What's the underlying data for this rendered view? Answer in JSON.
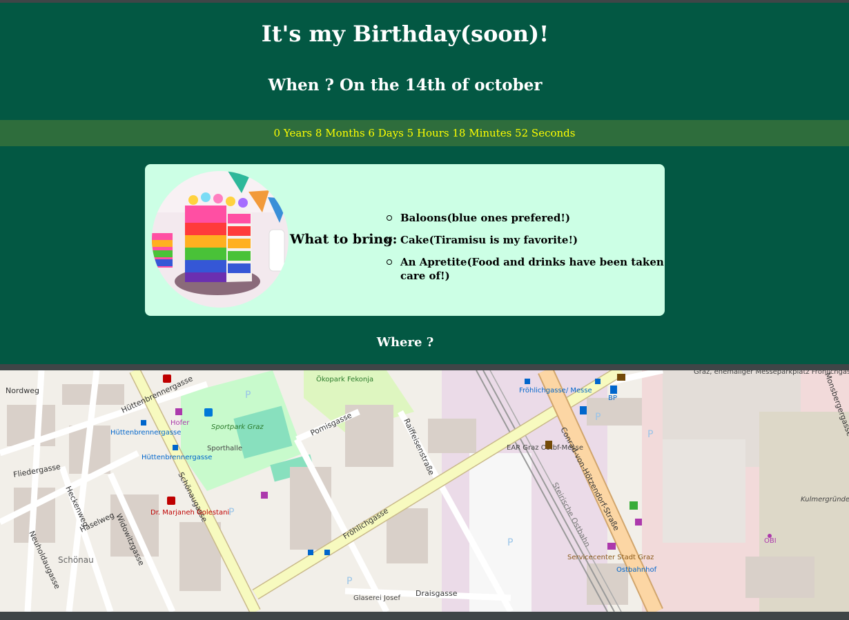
{
  "header": {
    "title": "It's my Birthday(soon)!",
    "subtitle": "When ? On the 14th of october"
  },
  "countdown": {
    "text": "0 Years 8 Months 6 Days 5 Hours 18 Minutes 52 Seconds"
  },
  "bring": {
    "label": "What to bring:",
    "items": [
      "Baloons(blue ones prefered!)",
      "Cake(Tiramisu is my favorite!)",
      "An Apretite(Food and drinks have been taken care of!)"
    ]
  },
  "where": {
    "label": "Where ?"
  },
  "map": {
    "streets": {
      "huettenbrennergasse": "Hüttenbrennergasse",
      "nordweg": "Nordweg",
      "fliedergasse": "Fliedergasse",
      "schoenaugasse": "Schönaugasse",
      "heckenweg": "Heckenweg",
      "haselweg": "Haselweg",
      "widowitzgasse": "Widowitzgasse",
      "neuholdaugasse": "Neuholdaugasse",
      "pomisgasse": "Pomisgasse",
      "raiffeisenstrasse": "Raiffeisenstraße",
      "froehlichgasse": "Fröhlichgasse",
      "draisgasse": "Draisgasse",
      "conrad": "Conrad-von-Hötzendorf-Straße",
      "ostbahn": "Steirische Ostbahn",
      "monsbergergasse": "Monsbergergasse"
    },
    "places": {
      "oekopark": "Ökopark Fekonja",
      "sportpark": "Sportpark Graz",
      "sporthalle": "Sporthalle",
      "hofer": "Hofer",
      "stop_huetten1": "Hüttenbrennergasse",
      "stop_huetten2": "Hüttenbrennergasse",
      "doctor": "Dr. Marjaneh Golestani",
      "schoenau": "Schönau",
      "ear": "EAR Graz Ostbf-Messe",
      "froehlich_messe": "Fröhlichgasse/ Messe",
      "bp": "BP",
      "messeparkplatz": "Graz, ehemaliger Messeparkplatz Fröhlichgasse",
      "servicecenter": "Servicecenter Stadt Graz",
      "ostbahnhof": "Ostbahnhof",
      "obi": "OBI",
      "kulmergrund": "Kulmergründe",
      "glaserei": "Glaserei Josef"
    },
    "colors": {
      "major_road": "#f7fabf",
      "primary_road": "#fcd6a4",
      "park": "#c8facc",
      "pitch": "#88e0be",
      "building": "#d9d0c9",
      "rail_area": "#ebdbe8"
    }
  }
}
